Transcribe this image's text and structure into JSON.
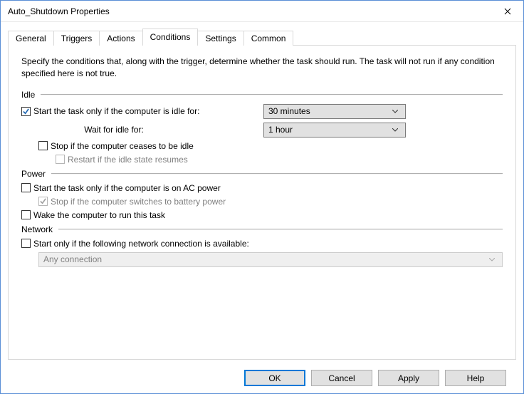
{
  "window": {
    "title": "Auto_Shutdown Properties"
  },
  "tabs": {
    "items": [
      {
        "label": "General"
      },
      {
        "label": "Triggers"
      },
      {
        "label": "Actions"
      },
      {
        "label": "Conditions"
      },
      {
        "label": "Settings"
      },
      {
        "label": "Common"
      }
    ],
    "active_index": 3
  },
  "panel": {
    "description": "Specify the conditions that, along with the trigger, determine whether the task should run. The task will not run if any condition specified here is not true.",
    "sections": {
      "idle": {
        "heading": "Idle",
        "start_if_idle": {
          "label": "Start the task only if the computer is idle for:",
          "checked": true,
          "value": "30 minutes"
        },
        "wait_for_idle": {
          "label": "Wait for idle for:",
          "value": "1 hour"
        },
        "stop_if_ceases": {
          "label": "Stop if the computer ceases to be idle",
          "checked": false
        },
        "restart_if_resumes": {
          "label": "Restart if the idle state resumes",
          "checked": false,
          "disabled": true
        }
      },
      "power": {
        "heading": "Power",
        "start_on_ac": {
          "label": "Start the task only if the computer is on AC power",
          "checked": false
        },
        "stop_on_battery": {
          "label": "Stop if the computer switches to battery power",
          "checked": true,
          "disabled": true
        },
        "wake_to_run": {
          "label": "Wake the computer to run this task",
          "checked": false
        }
      },
      "network": {
        "heading": "Network",
        "start_if_network": {
          "label": "Start only if the following network connection is available:",
          "checked": false
        },
        "connection": {
          "value": "Any connection",
          "disabled": true
        }
      }
    }
  },
  "buttons": {
    "ok": "OK",
    "cancel": "Cancel",
    "apply": "Apply",
    "help": "Help"
  }
}
